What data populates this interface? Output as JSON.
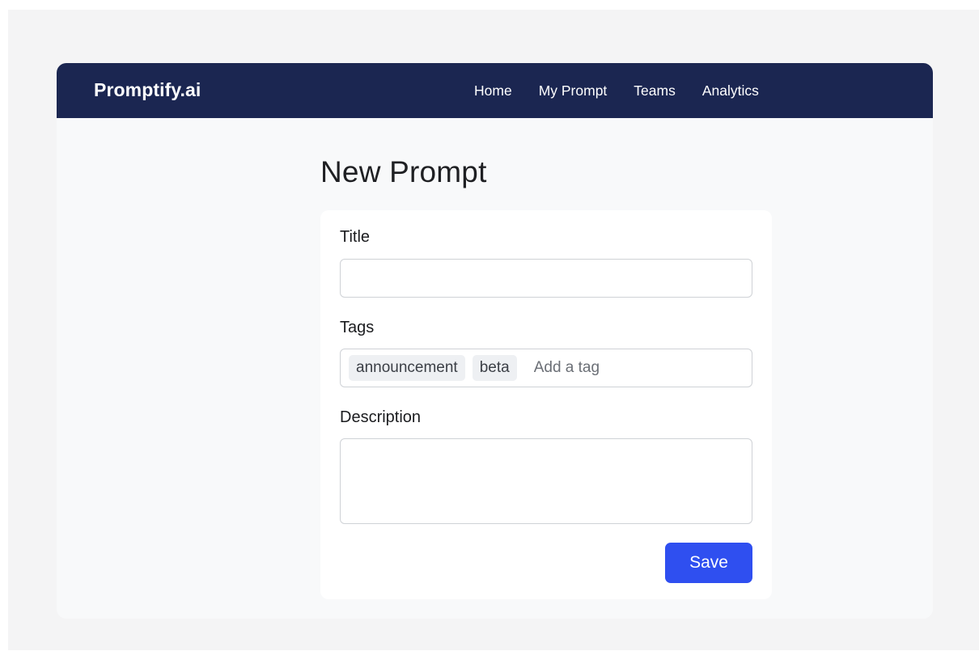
{
  "app": {
    "brand": "Promptify.ai"
  },
  "nav": {
    "items": [
      {
        "label": "Home"
      },
      {
        "label": "My Prompt"
      },
      {
        "label": "Teams"
      },
      {
        "label": "Analytics"
      }
    ]
  },
  "page": {
    "title": "New Prompt"
  },
  "form": {
    "title_label": "Title",
    "title_value": "",
    "tags_label": "Tags",
    "tags": [
      "announcement",
      "beta"
    ],
    "tag_placeholder": "Add a tag",
    "description_label": "Description",
    "description_value": "",
    "save_label": "Save"
  },
  "colors": {
    "navbar": "#1b2651",
    "primary_button": "#2f4ff0",
    "page_background": "#f8f9fa",
    "backdrop": "#f4f4f5"
  }
}
